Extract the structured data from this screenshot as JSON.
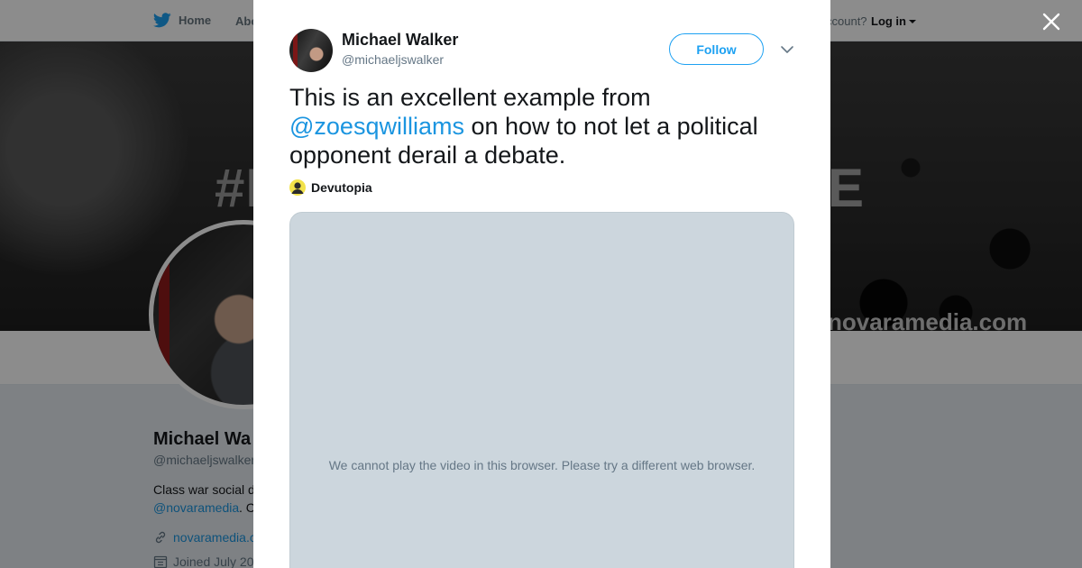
{
  "background": {
    "nav": {
      "home_label": "Home",
      "about_label": "Abo",
      "account_text": "ccount?",
      "login_label": "Log in"
    },
    "header": {
      "hashtag_left": "#I",
      "hashtag_right": "E",
      "url_text": "novaramedia.com"
    },
    "profile": {
      "name": "Michael Wa",
      "handle": "@michaeljswalker",
      "bio_line1": "Class war social d",
      "bio_link": "@novaramedia",
      "bio_rest": ". C",
      "website": "novaramedia.c",
      "joined": "Joined July 20"
    }
  },
  "tweet": {
    "author_name": "Michael Walker",
    "author_handle": "@michaeljswalker",
    "follow_label": "Follow",
    "text_before": "This is an excellent example from ",
    "mention": "@zoesqwilliams",
    "text_after": " on how to not let a political opponent derail a debate.",
    "source": "Devutopia",
    "video_message": "We cannot play the video in this browser. Please try a different web browser."
  },
  "colors": {
    "twitter_blue": "#1da1f2",
    "link_blue": "#1b95e0",
    "video_bg": "#ccd6dd"
  },
  "icons": {
    "close": "close-icon",
    "chevron": "chevron-down-icon",
    "bird": "twitter-bird-icon",
    "link": "link-icon",
    "calendar": "calendar-icon",
    "source": "source-avatar-icon"
  }
}
